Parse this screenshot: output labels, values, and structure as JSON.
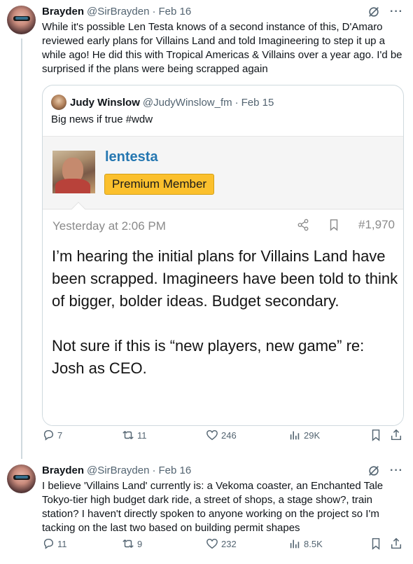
{
  "tweets": [
    {
      "author_name": "Brayden",
      "handle": "@SirBrayden",
      "separator": "·",
      "date": "Feb 16",
      "text": "While it's possible Len Testa knows of a second instance of this, D'Amaro reviewed early plans for Villains Land and told Imagineering to step it up a while ago! He did this with Tropical Americas & Villains over a year ago. I'd be surprised if the plans were being scrapped again",
      "quote": {
        "author_name": "Judy Winslow",
        "handle": "@JudyWinslow_fm",
        "separator": "·",
        "date": "Feb 15",
        "text": "Big news if true #wdw",
        "forum": {
          "username": "lentesta",
          "badge": "Premium Member",
          "timestamp": "Yesterday at 2:06 PM",
          "post_number": "#1,970",
          "paragraph_1": "I’m hearing the initial plans for Villains Land have been scrapped. Imagineers have been told to think of bigger, bolder ideas. Budget secondary.",
          "paragraph_2": "Not sure if this is “new players, new game” re: Josh as CEO."
        }
      },
      "stats": {
        "replies": "7",
        "retweets": "11",
        "likes": "246",
        "views": "29K"
      }
    },
    {
      "author_name": "Brayden",
      "handle": "@SirBrayden",
      "separator": "·",
      "date": "Feb 16",
      "text": "I believe 'Villains Land' currently is: a Vekoma coaster, an Enchanted Tale Tokyo-tier high budget dark ride, a street of shops, a stage show?, train station? I haven't directly spoken to anyone working on the project so I'm tacking on the last two based on building permit shapes",
      "stats": {
        "replies": "11",
        "retweets": "9",
        "likes": "232",
        "views": "8.5K"
      }
    }
  ],
  "colors": {
    "text": "#0f1419",
    "secondary": "#536471",
    "border": "#cfd9de",
    "forum_link": "#2577b1",
    "badge": "#fbc02d"
  },
  "icons": [
    "grok-icon",
    "more-icon",
    "reply-icon",
    "retweet-icon",
    "like-icon",
    "views-icon",
    "bookmark-icon",
    "share-icon",
    "forum-share-icon",
    "forum-bookmark-icon"
  ]
}
